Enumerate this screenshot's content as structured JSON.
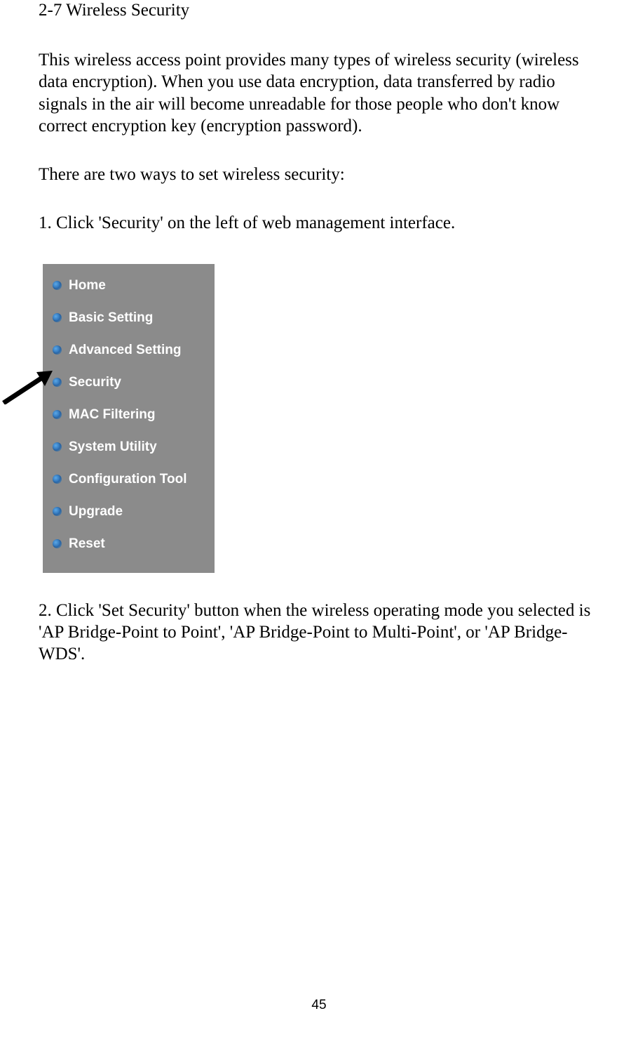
{
  "heading": "2-7 Wireless Security",
  "paragraph1": "This wireless access point provides many types of wireless security (wireless data encryption). When you use data encryption, data transferred by radio signals in the air will become unreadable for those people who don't know correct encryption key (encryption password).",
  "paragraph2": "There are two ways to set wireless security:",
  "paragraph3": "1. Click 'Security' on the left of web management interface.",
  "sidebar": {
    "items": [
      {
        "label": "Home"
      },
      {
        "label": "Basic Setting"
      },
      {
        "label": "Advanced Setting"
      },
      {
        "label": "Security"
      },
      {
        "label": "MAC Filtering"
      },
      {
        "label": "System Utility"
      },
      {
        "label": "Configuration Tool"
      },
      {
        "label": "Upgrade"
      },
      {
        "label": "Reset"
      }
    ]
  },
  "paragraph4": "2. Click 'Set Security' button when the wireless operating mode you selected is 'AP Bridge-Point to Point', 'AP Bridge-Point to Multi-Point', or 'AP Bridge-WDS'.",
  "pageNumber": "45"
}
